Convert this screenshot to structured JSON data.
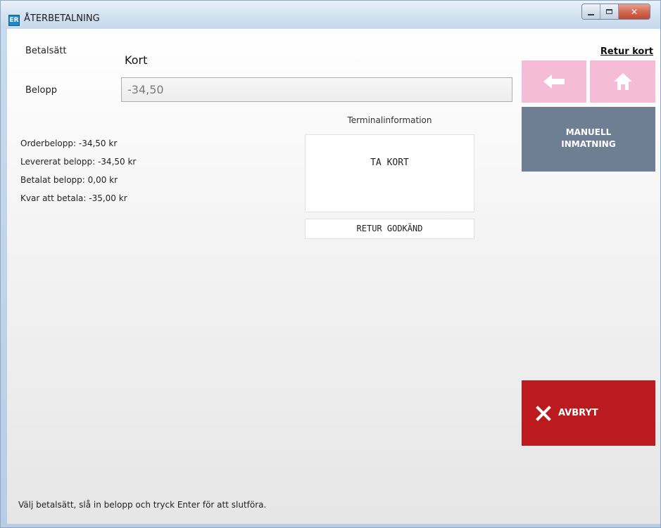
{
  "window": {
    "title": "ÅTERBETALNING",
    "icon_text": "ER",
    "icon": "er-app-icon",
    "controls": [
      "minimize-icon",
      "maximize-icon",
      "close-icon"
    ]
  },
  "form": {
    "method_label": "Betalsätt",
    "method_value": "Kort",
    "amount_label": "Belopp",
    "amount_value": "-34,50"
  },
  "summary": {
    "order_amount": "Orderbelopp: -34,50 kr",
    "delivered_amount": "Levererat belopp: -34,50 kr",
    "paid_amount": "Betalat belopp: 0,00 kr",
    "remaining": "Kvar att betala: -35,00 kr"
  },
  "terminal": {
    "title": "Terminalinformation",
    "display_text": "TA KORT",
    "status_text": "RETUR GODKÄND"
  },
  "actions": {
    "mode_title": "Retur kort",
    "back_icon": "arrow-left-icon",
    "home_icon": "home-icon",
    "manual_line1": "MANUELL",
    "manual_line2": "INMATNING",
    "cancel_label": "AVBRYT",
    "cancel_icon": "x-icon"
  },
  "colors": {
    "pink_tile": "#f5bcd8",
    "manual_button": "#6e7f93",
    "cancel_button": "#bb1b1f"
  },
  "footer": {
    "hint": "Välj betalsätt, slå in belopp och tryck Enter för att slutföra."
  }
}
